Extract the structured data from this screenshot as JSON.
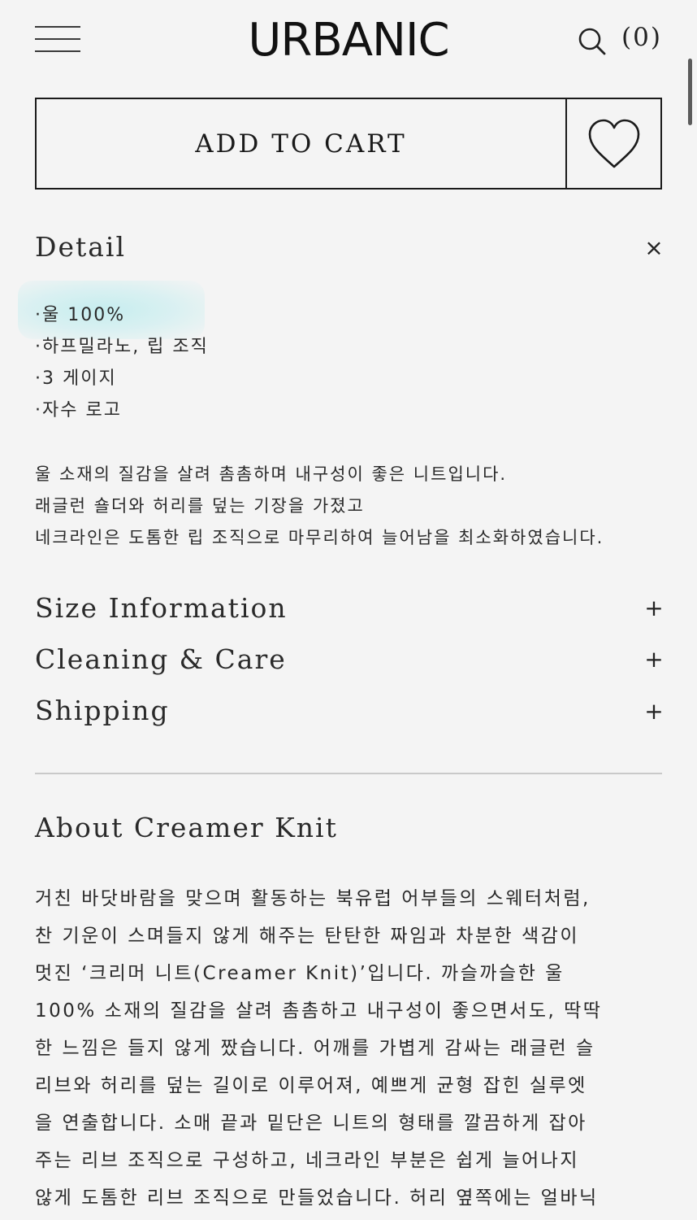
{
  "header": {
    "logo": "URBANIC",
    "cart_count": "(0)"
  },
  "actions": {
    "add_to_cart": "ADD TO CART"
  },
  "detail": {
    "title": "Detail",
    "toggle": "×",
    "bullets": [
      "·울 100%",
      "·하프밀라노, 립 조직",
      "·3 게이지",
      "·자수 로고"
    ],
    "description": [
      "울 소재의 질감을 살려 촘촘하며 내구성이 좋은 니트입니다.",
      "래글런 숄더와 허리를 덮는 기장을 가졌고",
      "네크라인은 도톰한 립 조직으로 마무리하여 늘어남을 최소화하였습니다."
    ]
  },
  "accordions": [
    {
      "title": "Size Information",
      "toggle": "+"
    },
    {
      "title": "Cleaning & Care",
      "toggle": "+"
    },
    {
      "title": "Shipping",
      "toggle": "+"
    }
  ],
  "about": {
    "title": "About Creamer Knit",
    "lines": [
      "거친 바닷바람을 맞으며 활동하는 북유럽 어부들의 스웨터처럼,",
      "찬 기운이 스며들지 않게 해주는 탄탄한 짜임과 차분한 색감이",
      "멋진 ‘크리머 니트(Creamer Knit)’입니다. 까슬까슬한 울",
      "100% 소재의 질감을 살려 촘촘하고 내구성이 좋으면서도, 딱딱",
      "한 느낌은 들지 않게 짰습니다. 어깨를 가볍게 감싸는 래글런 슬",
      "리브와 허리를 덮는 길이로 이루어져, 예쁘게 균형 잡힌 실루엣",
      "을 연출합니다. 소매 끝과 밑단은 니트의 형태를 깔끔하게 잡아",
      "주는 리브 조직으로 구성하고, 네크라인 부분은 쉽게 늘어나지",
      "않게 도톰한 리브 조직으로 만들었습니다. 허리 옆쪽에는 얼바닉"
    ]
  },
  "icons": {
    "menu": "hamburger-menu-icon",
    "search": "search-icon",
    "wishlist": "heart-icon"
  }
}
